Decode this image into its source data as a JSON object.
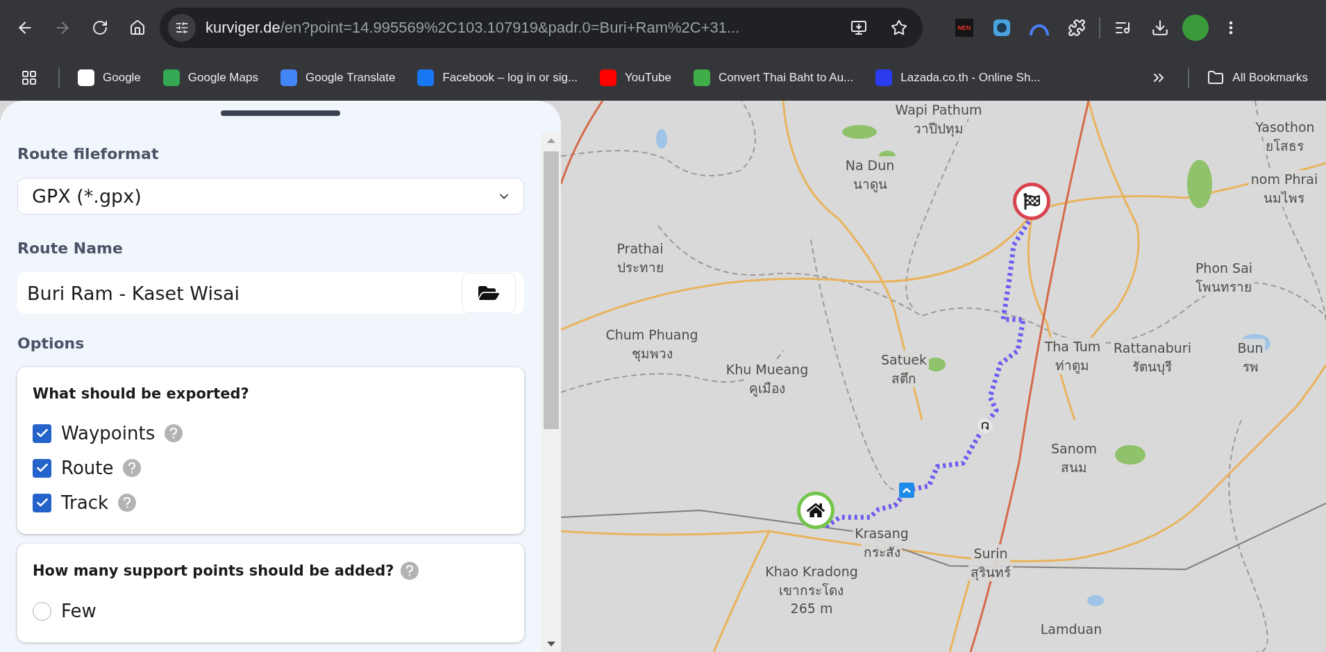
{
  "browser": {
    "address": {
      "host": "kurviger.de",
      "path": "/en?point=14.995569%2C103.107919&padr.0=Buri+Ram%2C+31..."
    },
    "extensions": [
      {
        "kind": "text",
        "label": "NEN"
      },
      {
        "kind": "round"
      },
      {
        "kind": "arc"
      },
      {
        "kind": "puzzle"
      }
    ],
    "bookmarks": [
      {
        "label": "Google",
        "kind": "google"
      },
      {
        "label": "Google Maps",
        "kind": "maps"
      },
      {
        "label": "Google Translate",
        "kind": "translate"
      },
      {
        "label": "Facebook – log in or sig...",
        "kind": "facebook"
      },
      {
        "label": "YouTube",
        "kind": "youtube"
      },
      {
        "label": "Convert Thai Baht to Au...",
        "kind": "bars"
      },
      {
        "label": "Lazada.co.th - Online Sh...",
        "kind": "lazada"
      }
    ],
    "all_bookmarks": "All Bookmarks"
  },
  "panel": {
    "route_format": {
      "label": "Route fileformat",
      "value": "GPX (*.gpx)"
    },
    "route_name": {
      "label": "Route Name",
      "value": "Buri Ram - Kaset Wisai"
    },
    "options_heading": "Options",
    "export_card": {
      "title": "What should be exported?",
      "items": [
        {
          "label": "Waypoints",
          "checked": true
        },
        {
          "label": "Route",
          "checked": true
        },
        {
          "label": "Track",
          "checked": true
        }
      ]
    },
    "support_card": {
      "title": "How many support points should be added?",
      "options": [
        {
          "label": "Few",
          "selected": false
        }
      ]
    }
  },
  "map": {
    "labels": [
      {
        "name": "Wapi Pathum",
        "local": "วาปีปทุม"
      },
      {
        "name": "Na Dun",
        "local": "นาดูน"
      },
      {
        "name": "Yasothon",
        "local": "ยโสธร"
      },
      {
        "name": "nom Phrai",
        "local": "นมไพร"
      },
      {
        "name": "Prathai",
        "local": "ประทาย"
      },
      {
        "name": "Phon Sai",
        "local": "โพนทราย"
      },
      {
        "name": "Chum Phuang",
        "local": "ชุมพวง"
      },
      {
        "name": "Tha Tum",
        "local": "ท่าตูม"
      },
      {
        "name": "Rattanaburi",
        "local": "รัตนบุรี"
      },
      {
        "name": "Bun",
        "local": "รพ"
      },
      {
        "name": "Khu Mueang",
        "local": "คูเมือง"
      },
      {
        "name": "Satuek",
        "local": "สตึก"
      },
      {
        "name": "Sanom",
        "local": "สนม"
      },
      {
        "name": "Krasang",
        "local": "กระสัง"
      },
      {
        "name": "Khao Kradong",
        "local": "เขากระโดง",
        "extra": "265 m"
      },
      {
        "name": "Surin",
        "local": "สุรินทร์"
      },
      {
        "name": "Lamduan"
      }
    ]
  }
}
